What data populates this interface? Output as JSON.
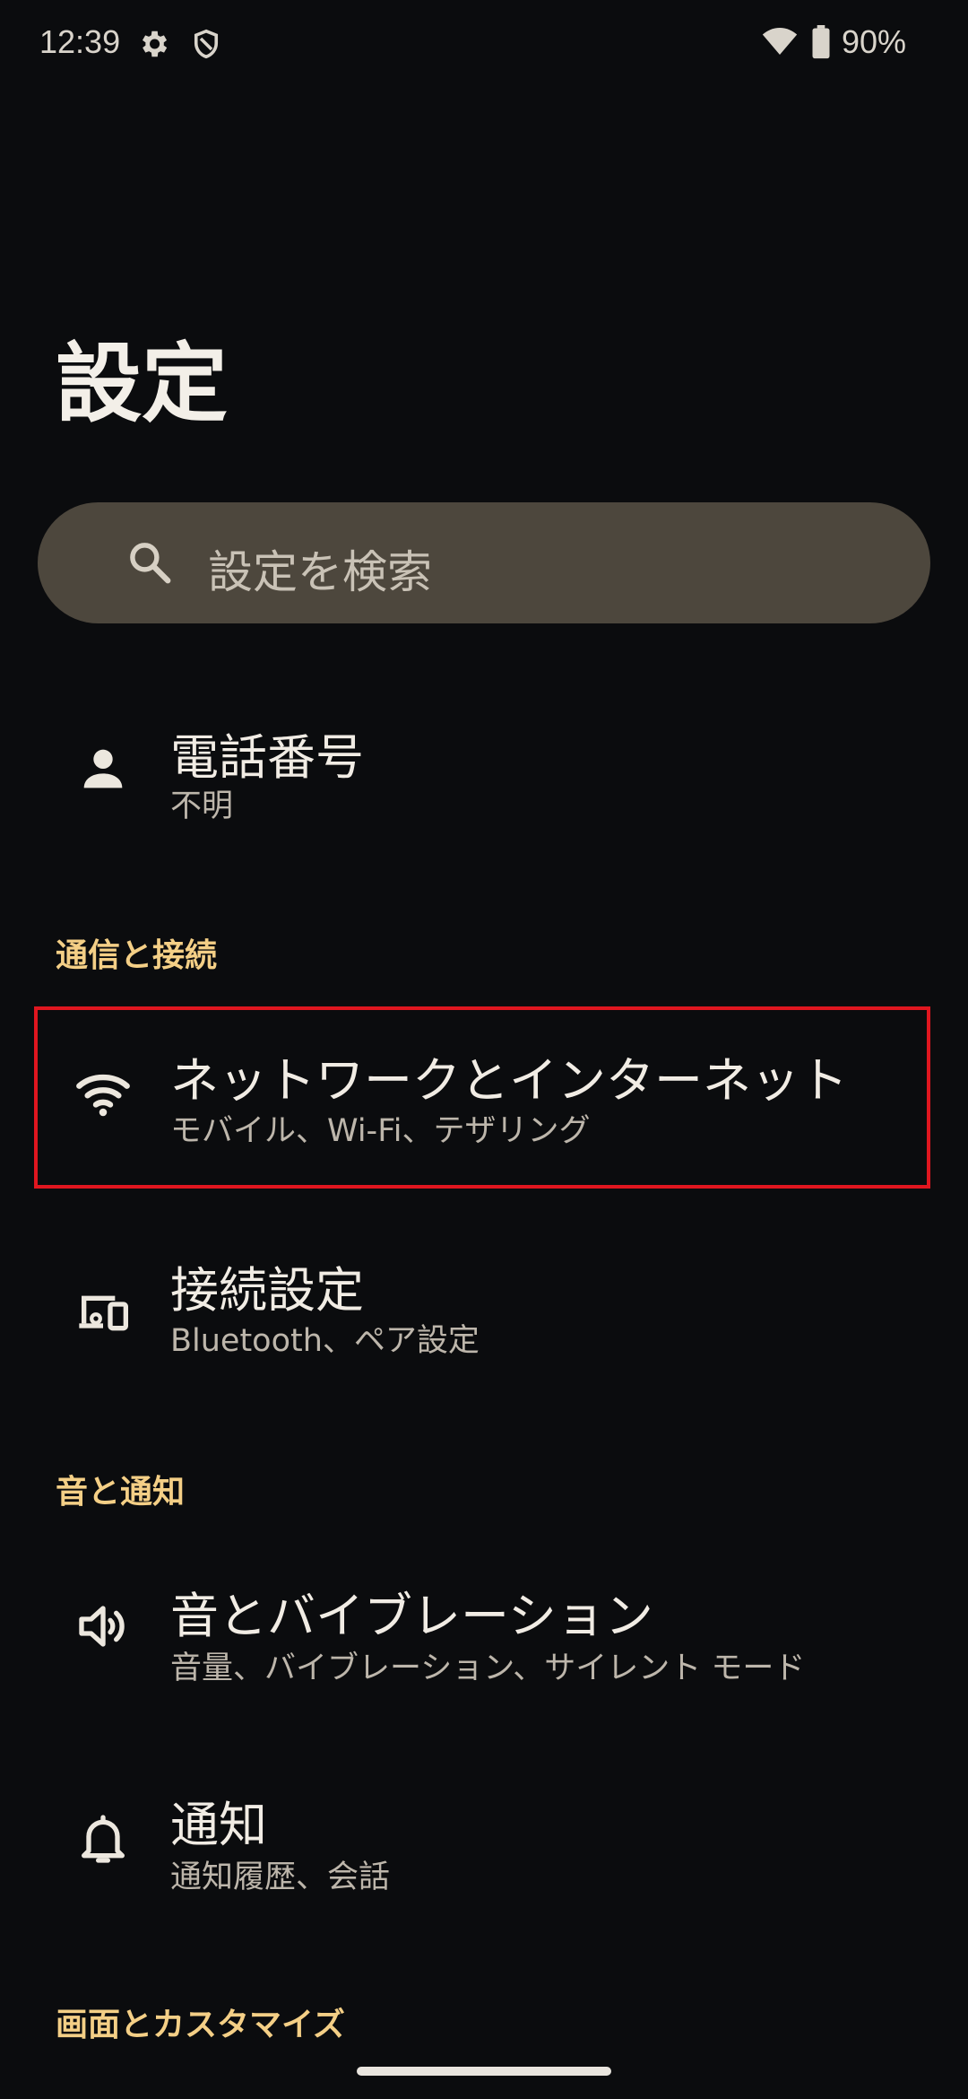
{
  "status_bar": {
    "time": "12:39",
    "battery": "90%",
    "icons": [
      "gear-icon",
      "shield-icon",
      "wifi-icon",
      "battery-icon"
    ]
  },
  "page": {
    "title": "設定"
  },
  "search": {
    "placeholder": "設定を検索"
  },
  "items": {
    "phone": {
      "title": "電話番号",
      "subtitle": "不明",
      "icon": "person-icon"
    },
    "network": {
      "title": "ネットワークとインターネット",
      "subtitle": "モバイル、Wi-Fi、テザリング",
      "icon": "wifi-icon"
    },
    "connected": {
      "title": "接続設定",
      "subtitle": "Bluetooth、ペア設定",
      "icon": "devices-icon"
    },
    "sound": {
      "title": "音とバイブレーション",
      "subtitle": "音量、バイブレーション、サイレント モード",
      "icon": "speaker-icon"
    },
    "notifications": {
      "title": "通知",
      "subtitle": "通知履歴、会話",
      "icon": "bell-icon"
    }
  },
  "sections": {
    "connections": "通信と接続",
    "sound_notifications": "音と通知",
    "display": "画面とカスタマイズ"
  },
  "colors": {
    "background": "#0b0c0e",
    "search_bar": "#4d473d",
    "section_header": "#f4cf86",
    "highlight": "#e0161f"
  }
}
